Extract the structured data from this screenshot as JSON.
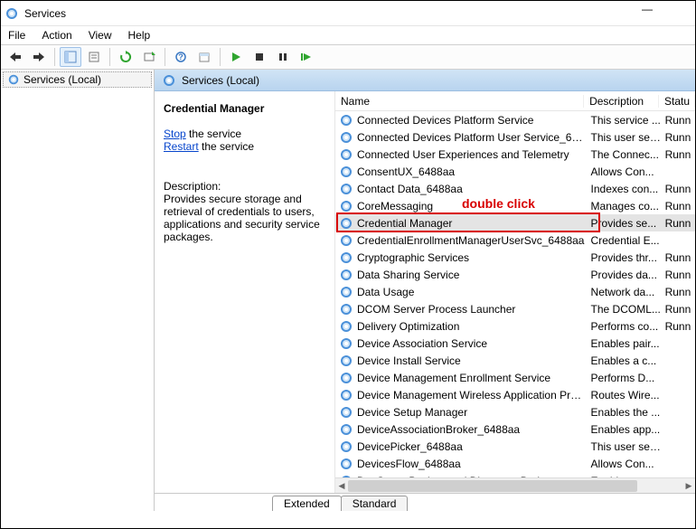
{
  "window": {
    "title": "Services"
  },
  "menu": {
    "file": "File",
    "action": "Action",
    "view": "View",
    "help": "Help"
  },
  "tree": {
    "root": "Services (Local)"
  },
  "header": {
    "title": "Services (Local)"
  },
  "detail": {
    "title": "Credential Manager",
    "stop": "Stop",
    "stop_suffix": " the service",
    "restart": "Restart",
    "restart_suffix": " the service",
    "desc_label": "Description:",
    "desc_text": "Provides secure storage and retrieval of credentials to users, applications and security service packages."
  },
  "columns": {
    "name": "Name",
    "description": "Description",
    "status": "Statu"
  },
  "annotation": "double click",
  "tabs": {
    "extended": "Extended",
    "standard": "Standard"
  },
  "services": [
    {
      "name": "Connected Devices Platform Service",
      "desc": "This service ...",
      "status": "Runn"
    },
    {
      "name": "Connected Devices Platform User Service_6488aa",
      "desc": "This user ser...",
      "status": "Runn"
    },
    {
      "name": "Connected User Experiences and Telemetry",
      "desc": "The Connec...",
      "status": "Runn"
    },
    {
      "name": "ConsentUX_6488aa",
      "desc": "Allows Con...",
      "status": ""
    },
    {
      "name": "Contact Data_6488aa",
      "desc": "Indexes con...",
      "status": "Runn"
    },
    {
      "name": "CoreMessaging",
      "desc": "Manages co...",
      "status": "Runn"
    },
    {
      "name": "Credential Manager",
      "desc": "Provides se...",
      "status": "Runn",
      "selected": true
    },
    {
      "name": "CredentialEnrollmentManagerUserSvc_6488aa",
      "desc": "Credential E...",
      "status": ""
    },
    {
      "name": "Cryptographic Services",
      "desc": "Provides thr...",
      "status": "Runn"
    },
    {
      "name": "Data Sharing Service",
      "desc": "Provides da...",
      "status": "Runn"
    },
    {
      "name": "Data Usage",
      "desc": "Network da...",
      "status": "Runn"
    },
    {
      "name": "DCOM Server Process Launcher",
      "desc": "The DCOML...",
      "status": "Runn"
    },
    {
      "name": "Delivery Optimization",
      "desc": "Performs co...",
      "status": "Runn"
    },
    {
      "name": "Device Association Service",
      "desc": "Enables pair...",
      "status": ""
    },
    {
      "name": "Device Install Service",
      "desc": "Enables a c...",
      "status": ""
    },
    {
      "name": "Device Management Enrollment Service",
      "desc": "Performs D...",
      "status": ""
    },
    {
      "name": "Device Management Wireless Application Protocol...",
      "desc": "Routes Wire...",
      "status": ""
    },
    {
      "name": "Device Setup Manager",
      "desc": "Enables the ...",
      "status": ""
    },
    {
      "name": "DeviceAssociationBroker_6488aa",
      "desc": "Enables app...",
      "status": ""
    },
    {
      "name": "DevicePicker_6488aa",
      "desc": "This user ser...",
      "status": ""
    },
    {
      "name": "DevicesFlow_6488aa",
      "desc": "Allows Con...",
      "status": ""
    },
    {
      "name": "DevQuery Background Discovery Broker",
      "desc": "Enables app...",
      "status": ""
    }
  ]
}
